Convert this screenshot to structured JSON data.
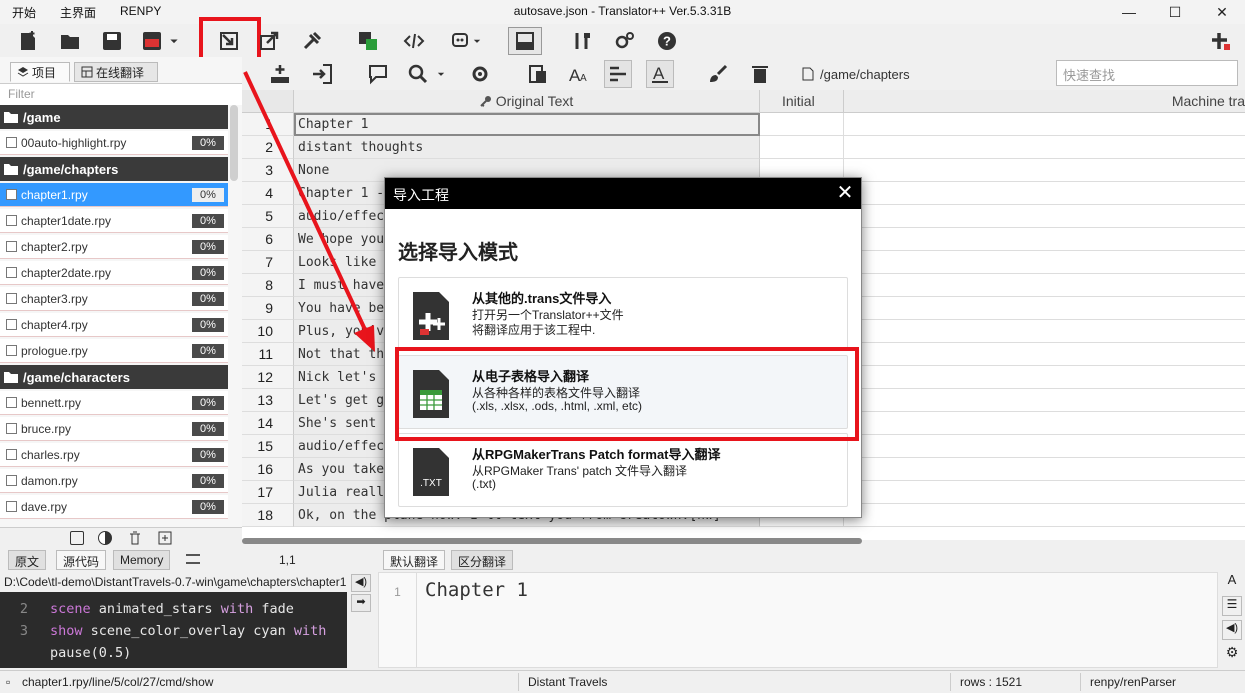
{
  "menu": [
    "开始",
    "主界面",
    "RENPY"
  ],
  "window_title": "autosave.json - Translator++ Ver.5.3.31B",
  "window_controls": {
    "minimize": "—",
    "maximize": "☐",
    "close": "✕"
  },
  "left_panel": {
    "tabs": [
      "项目",
      "在线翻译"
    ],
    "filter_placeholder": "Filter",
    "tree": [
      {
        "type": "folder",
        "label": "/game"
      },
      {
        "type": "file",
        "label": "00auto-highlight.rpy",
        "pct": "0%"
      },
      {
        "type": "folder",
        "label": "/game/chapters"
      },
      {
        "type": "file",
        "label": "chapter1.rpy",
        "pct": "0%",
        "selected": true
      },
      {
        "type": "file",
        "label": "chapter1date.rpy",
        "pct": "0%"
      },
      {
        "type": "file",
        "label": "chapter2.rpy",
        "pct": "0%"
      },
      {
        "type": "file",
        "label": "chapter2date.rpy",
        "pct": "0%"
      },
      {
        "type": "file",
        "label": "chapter3.rpy",
        "pct": "0%"
      },
      {
        "type": "file",
        "label": "chapter4.rpy",
        "pct": "0%"
      },
      {
        "type": "file",
        "label": "prologue.rpy",
        "pct": "0%"
      },
      {
        "type": "folder",
        "label": "/game/characters"
      },
      {
        "type": "file",
        "label": "bennett.rpy",
        "pct": "0%"
      },
      {
        "type": "file",
        "label": "bruce.rpy",
        "pct": "0%"
      },
      {
        "type": "file",
        "label": "charles.rpy",
        "pct": "0%"
      },
      {
        "type": "file",
        "label": "damon.rpy",
        "pct": "0%"
      },
      {
        "type": "file",
        "label": "dave.rpy",
        "pct": "0%"
      }
    ]
  },
  "path_field": "/game/chapters",
  "quick_search_placeholder": "快速查找",
  "grid": {
    "headers": {
      "original": "Original Text",
      "initial": "Initial",
      "machine": "Machine tra"
    },
    "rows": [
      {
        "n": "1",
        "text": "Chapter 1"
      },
      {
        "n": "2",
        "text": "distant thoughts"
      },
      {
        "n": "3",
        "text": "None"
      },
      {
        "n": "4",
        "text": "Chapter 1 -"
      },
      {
        "n": "5",
        "text": "audio/effect"
      },
      {
        "n": "6",
        "text": "We hope you"
      },
      {
        "n": "7",
        "text": "Looks like I"
      },
      {
        "n": "8",
        "text": "I must have"
      },
      {
        "n": "9",
        "text": "You have bee"
      },
      {
        "n": "10",
        "text": "Plus, you've"
      },
      {
        "n": "11",
        "text": "Not that th"
      },
      {
        "n": "12",
        "text": "Nick let's"
      },
      {
        "n": "13",
        "text": "Let's get g"
      },
      {
        "n": "14",
        "text": "She's sent"
      },
      {
        "n": "15",
        "text": "audio/effect"
      },
      {
        "n": "16",
        "text": "As you take"
      },
      {
        "n": "17",
        "text": "Julia really"
      },
      {
        "n": "18",
        "text": "Ok, on the plane now. I'll text you from Greatown.[nw]"
      }
    ]
  },
  "bottom_left": {
    "tabs": [
      "原文",
      "源代码",
      "Memory"
    ],
    "cursor": "1,1",
    "file_path": "D:\\Code\\tl-demo\\DistantTravels-0.7-win\\game\\chapters\\chapter1.rpy",
    "code": [
      {
        "n": "2",
        "kw": "scene",
        "rest": " animated_stars ",
        "kw2": "with",
        "rest2": " fade"
      },
      {
        "n": "3",
        "kw": "show",
        "rest": " scene_color_overlay cyan ",
        "kw2": "with",
        "rest2": ""
      },
      {
        "n": "",
        "kw": "",
        "rest": "pause(0.5)",
        "kw2": "",
        "rest2": ""
      }
    ]
  },
  "bottom_right": {
    "tabs": [
      "默认翻译",
      "区分翻译"
    ],
    "line_no": "1",
    "text": "Chapter 1"
  },
  "status": {
    "location": "chapter1.rpy/line/5/col/27/cmd/show",
    "project": "Distant Travels",
    "rows": "rows : 1521",
    "parser": "renpy/renParser"
  },
  "dialog": {
    "title": "导入工程",
    "heading": "选择导入模式",
    "options": [
      {
        "title": "从其他的.trans文件导入",
        "line1": "打开另一个Translator++文件",
        "line2": "将翻译应用于该工程中."
      },
      {
        "title": "从电子表格导入翻译",
        "line1": "从各种各样的表格文件导入翻译",
        "line2": "(.xls, .xlsx, .ods, .html, .xml, etc)"
      },
      {
        "title": "从RPGMakerTrans Patch format导入翻译",
        "line1": "从RPGMaker Trans' patch 文件导入翻译",
        "line2": "(.txt)"
      }
    ],
    "txt_icon_label": ".TXT"
  },
  "colors": {
    "highlight": "#e8141c",
    "selection": "#3399ff",
    "folder_bg": "#3a3a3a"
  }
}
